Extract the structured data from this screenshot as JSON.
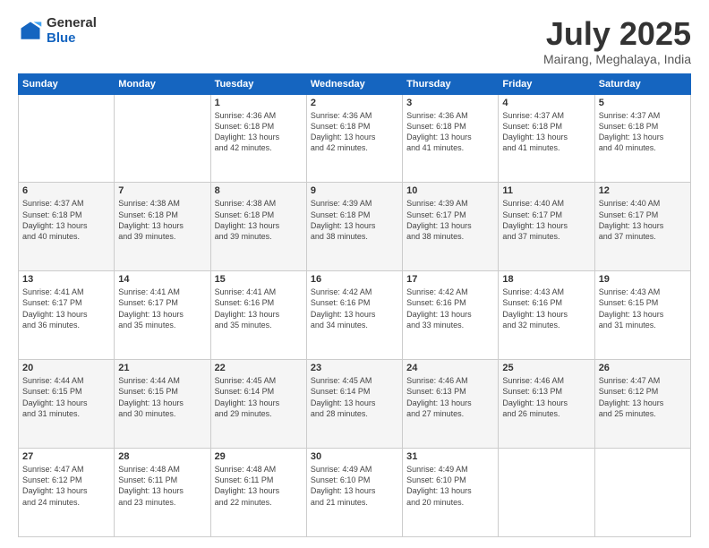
{
  "logo": {
    "general": "General",
    "blue": "Blue"
  },
  "header": {
    "title": "July 2025",
    "subtitle": "Mairang, Meghalaya, India"
  },
  "weekdays": [
    "Sunday",
    "Monday",
    "Tuesday",
    "Wednesday",
    "Thursday",
    "Friday",
    "Saturday"
  ],
  "weeks": [
    [
      {
        "day": "",
        "info": ""
      },
      {
        "day": "",
        "info": ""
      },
      {
        "day": "1",
        "info": "Sunrise: 4:36 AM\nSunset: 6:18 PM\nDaylight: 13 hours\nand 42 minutes."
      },
      {
        "day": "2",
        "info": "Sunrise: 4:36 AM\nSunset: 6:18 PM\nDaylight: 13 hours\nand 42 minutes."
      },
      {
        "day": "3",
        "info": "Sunrise: 4:36 AM\nSunset: 6:18 PM\nDaylight: 13 hours\nand 41 minutes."
      },
      {
        "day": "4",
        "info": "Sunrise: 4:37 AM\nSunset: 6:18 PM\nDaylight: 13 hours\nand 41 minutes."
      },
      {
        "day": "5",
        "info": "Sunrise: 4:37 AM\nSunset: 6:18 PM\nDaylight: 13 hours\nand 40 minutes."
      }
    ],
    [
      {
        "day": "6",
        "info": "Sunrise: 4:37 AM\nSunset: 6:18 PM\nDaylight: 13 hours\nand 40 minutes."
      },
      {
        "day": "7",
        "info": "Sunrise: 4:38 AM\nSunset: 6:18 PM\nDaylight: 13 hours\nand 39 minutes."
      },
      {
        "day": "8",
        "info": "Sunrise: 4:38 AM\nSunset: 6:18 PM\nDaylight: 13 hours\nand 39 minutes."
      },
      {
        "day": "9",
        "info": "Sunrise: 4:39 AM\nSunset: 6:18 PM\nDaylight: 13 hours\nand 38 minutes."
      },
      {
        "day": "10",
        "info": "Sunrise: 4:39 AM\nSunset: 6:17 PM\nDaylight: 13 hours\nand 38 minutes."
      },
      {
        "day": "11",
        "info": "Sunrise: 4:40 AM\nSunset: 6:17 PM\nDaylight: 13 hours\nand 37 minutes."
      },
      {
        "day": "12",
        "info": "Sunrise: 4:40 AM\nSunset: 6:17 PM\nDaylight: 13 hours\nand 37 minutes."
      }
    ],
    [
      {
        "day": "13",
        "info": "Sunrise: 4:41 AM\nSunset: 6:17 PM\nDaylight: 13 hours\nand 36 minutes."
      },
      {
        "day": "14",
        "info": "Sunrise: 4:41 AM\nSunset: 6:17 PM\nDaylight: 13 hours\nand 35 minutes."
      },
      {
        "day": "15",
        "info": "Sunrise: 4:41 AM\nSunset: 6:16 PM\nDaylight: 13 hours\nand 35 minutes."
      },
      {
        "day": "16",
        "info": "Sunrise: 4:42 AM\nSunset: 6:16 PM\nDaylight: 13 hours\nand 34 minutes."
      },
      {
        "day": "17",
        "info": "Sunrise: 4:42 AM\nSunset: 6:16 PM\nDaylight: 13 hours\nand 33 minutes."
      },
      {
        "day": "18",
        "info": "Sunrise: 4:43 AM\nSunset: 6:16 PM\nDaylight: 13 hours\nand 32 minutes."
      },
      {
        "day": "19",
        "info": "Sunrise: 4:43 AM\nSunset: 6:15 PM\nDaylight: 13 hours\nand 31 minutes."
      }
    ],
    [
      {
        "day": "20",
        "info": "Sunrise: 4:44 AM\nSunset: 6:15 PM\nDaylight: 13 hours\nand 31 minutes."
      },
      {
        "day": "21",
        "info": "Sunrise: 4:44 AM\nSunset: 6:15 PM\nDaylight: 13 hours\nand 30 minutes."
      },
      {
        "day": "22",
        "info": "Sunrise: 4:45 AM\nSunset: 6:14 PM\nDaylight: 13 hours\nand 29 minutes."
      },
      {
        "day": "23",
        "info": "Sunrise: 4:45 AM\nSunset: 6:14 PM\nDaylight: 13 hours\nand 28 minutes."
      },
      {
        "day": "24",
        "info": "Sunrise: 4:46 AM\nSunset: 6:13 PM\nDaylight: 13 hours\nand 27 minutes."
      },
      {
        "day": "25",
        "info": "Sunrise: 4:46 AM\nSunset: 6:13 PM\nDaylight: 13 hours\nand 26 minutes."
      },
      {
        "day": "26",
        "info": "Sunrise: 4:47 AM\nSunset: 6:12 PM\nDaylight: 13 hours\nand 25 minutes."
      }
    ],
    [
      {
        "day": "27",
        "info": "Sunrise: 4:47 AM\nSunset: 6:12 PM\nDaylight: 13 hours\nand 24 minutes."
      },
      {
        "day": "28",
        "info": "Sunrise: 4:48 AM\nSunset: 6:11 PM\nDaylight: 13 hours\nand 23 minutes."
      },
      {
        "day": "29",
        "info": "Sunrise: 4:48 AM\nSunset: 6:11 PM\nDaylight: 13 hours\nand 22 minutes."
      },
      {
        "day": "30",
        "info": "Sunrise: 4:49 AM\nSunset: 6:10 PM\nDaylight: 13 hours\nand 21 minutes."
      },
      {
        "day": "31",
        "info": "Sunrise: 4:49 AM\nSunset: 6:10 PM\nDaylight: 13 hours\nand 20 minutes."
      },
      {
        "day": "",
        "info": ""
      },
      {
        "day": "",
        "info": ""
      }
    ]
  ]
}
